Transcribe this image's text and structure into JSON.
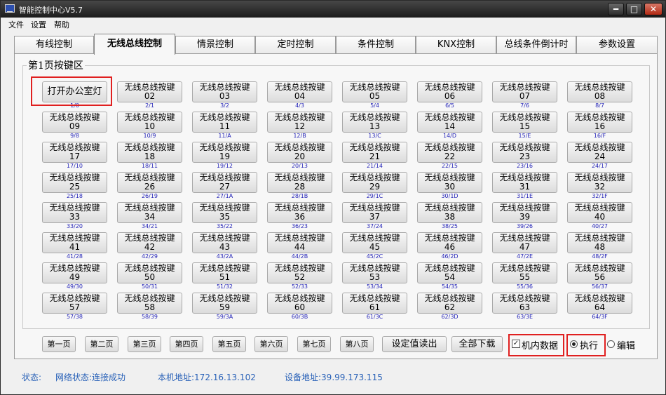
{
  "window": {
    "title": "智能控制中心V5.7",
    "controls": [
      "━",
      "□",
      "✕"
    ]
  },
  "menu": [
    "文件",
    "设置",
    "帮助"
  ],
  "tabs": [
    {
      "label": "有线控制",
      "active": false
    },
    {
      "label": "无线总线控制",
      "active": true
    },
    {
      "label": "情景控制",
      "active": false
    },
    {
      "label": "定时控制",
      "active": false
    },
    {
      "label": "条件控制",
      "active": false
    },
    {
      "label": "KNX控制",
      "active": false
    },
    {
      "label": "总线条件倒计时",
      "active": false
    },
    {
      "label": "参数设置",
      "active": false
    }
  ],
  "group_title": "第1页按键区",
  "key_prefix": "无线总线按键",
  "keys": [
    {
      "label": "打开办公室灯",
      "addr": "1/0"
    },
    {
      "num": "02",
      "addr": "2/1"
    },
    {
      "num": "03",
      "addr": "3/2"
    },
    {
      "num": "04",
      "addr": "4/3"
    },
    {
      "num": "05",
      "addr": "5/4"
    },
    {
      "num": "06",
      "addr": "6/5"
    },
    {
      "num": "07",
      "addr": "7/6"
    },
    {
      "num": "08",
      "addr": "8/7"
    },
    {
      "num": "09",
      "addr": "9/8"
    },
    {
      "num": "10",
      "addr": "10/9"
    },
    {
      "num": "11",
      "addr": "11/A"
    },
    {
      "num": "12",
      "addr": "12/B"
    },
    {
      "num": "13",
      "addr": "13/C"
    },
    {
      "num": "14",
      "addr": "14/D"
    },
    {
      "num": "15",
      "addr": "15/E"
    },
    {
      "num": "16",
      "addr": "16/F"
    },
    {
      "num": "17",
      "addr": "17/10"
    },
    {
      "num": "18",
      "addr": "18/11"
    },
    {
      "num": "19",
      "addr": "19/12"
    },
    {
      "num": "20",
      "addr": "20/13"
    },
    {
      "num": "21",
      "addr": "21/14"
    },
    {
      "num": "22",
      "addr": "22/15"
    },
    {
      "num": "23",
      "addr": "23/16"
    },
    {
      "num": "24",
      "addr": "24/17"
    },
    {
      "num": "25",
      "addr": "25/18"
    },
    {
      "num": "26",
      "addr": "26/19"
    },
    {
      "num": "27",
      "addr": "27/1A"
    },
    {
      "num": "28",
      "addr": "28/1B"
    },
    {
      "num": "29",
      "addr": "29/1C"
    },
    {
      "num": "30",
      "addr": "30/1D"
    },
    {
      "num": "31",
      "addr": "31/1E"
    },
    {
      "num": "32",
      "addr": "32/1F"
    },
    {
      "num": "33",
      "addr": "33/20"
    },
    {
      "num": "34",
      "addr": "34/21"
    },
    {
      "num": "35",
      "addr": "35/22"
    },
    {
      "num": "36",
      "addr": "36/23"
    },
    {
      "num": "37",
      "addr": "37/24"
    },
    {
      "num": "38",
      "addr": "38/25"
    },
    {
      "num": "39",
      "addr": "39/26"
    },
    {
      "num": "40",
      "addr": "40/27"
    },
    {
      "num": "41",
      "addr": "41/28"
    },
    {
      "num": "42",
      "addr": "42/29"
    },
    {
      "num": "43",
      "addr": "43/2A"
    },
    {
      "num": "44",
      "addr": "44/2B"
    },
    {
      "num": "45",
      "addr": "45/2C"
    },
    {
      "num": "46",
      "addr": "46/2D"
    },
    {
      "num": "47",
      "addr": "47/2E"
    },
    {
      "num": "48",
      "addr": "48/2F"
    },
    {
      "num": "49",
      "addr": "49/30"
    },
    {
      "num": "50",
      "addr": "50/31"
    },
    {
      "num": "51",
      "addr": "51/32"
    },
    {
      "num": "52",
      "addr": "52/33"
    },
    {
      "num": "53",
      "addr": "53/34"
    },
    {
      "num": "54",
      "addr": "54/35"
    },
    {
      "num": "55",
      "addr": "55/36"
    },
    {
      "num": "56",
      "addr": "56/37"
    },
    {
      "num": "57",
      "addr": "57/38"
    },
    {
      "num": "58",
      "addr": "58/39"
    },
    {
      "num": "59",
      "addr": "59/3A"
    },
    {
      "num": "60",
      "addr": "60/3B"
    },
    {
      "num": "61",
      "addr": "61/3C"
    },
    {
      "num": "62",
      "addr": "62/3D"
    },
    {
      "num": "63",
      "addr": "63/3E"
    },
    {
      "num": "64",
      "addr": "64/3F"
    }
  ],
  "pages": [
    "第一页",
    "第二页",
    "第三页",
    "第四页",
    "第五页",
    "第六页",
    "第七页",
    "第八页"
  ],
  "actions": {
    "read": "设定值读出",
    "download": "全部下载"
  },
  "options": {
    "internal_data": {
      "label": "机内数据",
      "checked": true,
      "mark": "✓"
    },
    "execute": {
      "label": "执行",
      "selected": true
    },
    "edit": {
      "label": "编辑",
      "selected": false
    }
  },
  "status": {
    "label": "状态:",
    "network": "网络状态:连接成功",
    "local_addr": "本机地址:172.16.13.102",
    "device_addr": "设备地址:39.99.173.115"
  },
  "colors": {
    "highlight": "#e02020",
    "addr_text": "#2424b8",
    "status_text": "#2a62b8"
  }
}
